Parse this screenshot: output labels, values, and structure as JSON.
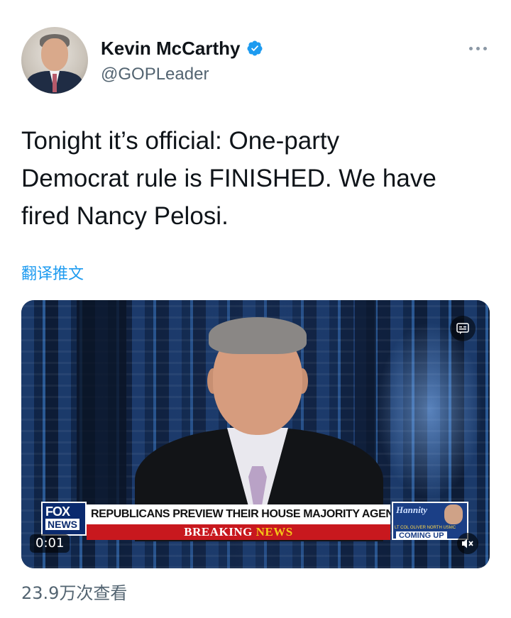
{
  "tweet": {
    "author": {
      "display_name": "Kevin McCarthy",
      "handle": "@GOPLeader",
      "verified": true,
      "avatar_icon": "profile-photo"
    },
    "text": "Tonight it’s official: One-party\nDemocrat rule is FINISHED. We have\nfired Nancy Pelosi.",
    "translate_link": "翻译推文",
    "view_count": "23.9万次查看",
    "accent_color": "#1d9bf0"
  },
  "video": {
    "timestamp": "0:01",
    "muted": true,
    "chyron": {
      "network_line1": "FOX",
      "network_line2": "NEWS",
      "headline": "REPUBLICANS PREVIEW THEIR HOUSE MAJORITY AGENDA",
      "breaking_part1": "BREAKING",
      "breaking_part2": "NEWS",
      "show_name": "Hannity",
      "show_ticker": "LT COL OLIVER NORTH USMC",
      "show_coming": "COMING UP"
    }
  }
}
